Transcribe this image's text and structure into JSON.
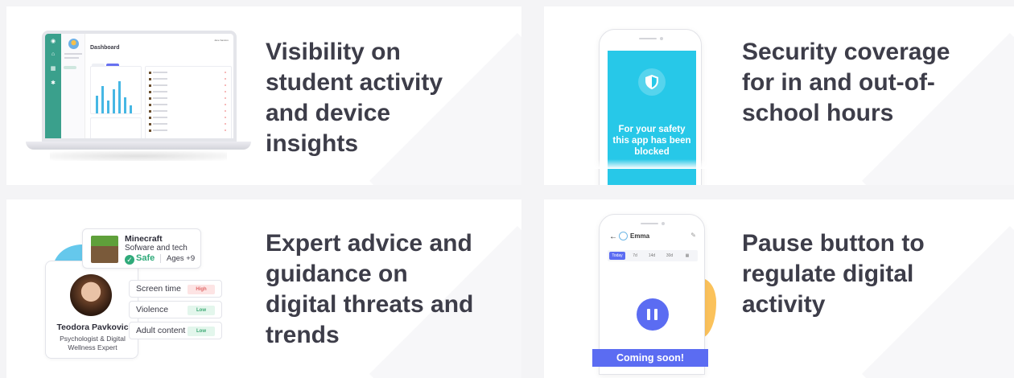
{
  "cards": [
    {
      "title": "Visibility on student activity and device insights",
      "laptop": {
        "dashboard_title": "Dashboard",
        "user_label": "Jane Santoro"
      }
    },
    {
      "title": "Security coverage for in and out-of-school hours",
      "phone": {
        "block_message": "For your safety this app has been blocked"
      }
    },
    {
      "title": "Expert advice and guidance on digital threats and trends",
      "app_card": {
        "name": "Minecraft",
        "category": "Sofware and tech",
        "status": "Safe",
        "ages": "Ages +9"
      },
      "expert": {
        "name": "Teodora Pavkovic",
        "role": "Psychologist & Digital Wellness Expert"
      },
      "ratings": [
        {
          "label": "Screen time",
          "level": "High"
        },
        {
          "label": "Violence",
          "level": "Low"
        },
        {
          "label": "Adult content",
          "level": "Low"
        }
      ]
    },
    {
      "title": "Pause button to regulate digital activity",
      "phone": {
        "back_arrow": "←",
        "child_name": "Emma",
        "tabs": [
          "Today",
          "7d",
          "14d",
          "30d"
        ],
        "badge": "Coming soon!"
      }
    }
  ],
  "colors": {
    "accent_blue": "#5b6cf2",
    "cyan": "#27c8e8",
    "teal_rail": "#3aa08c",
    "safe_green": "#2faa7a",
    "high_red": "#e06868",
    "low_green": "#3aa872"
  },
  "icons": {
    "shield": "shield-icon",
    "pause": "pause-icon",
    "check": "check-circle-icon",
    "calendar": "calendar-icon",
    "edit": "edit-icon"
  }
}
